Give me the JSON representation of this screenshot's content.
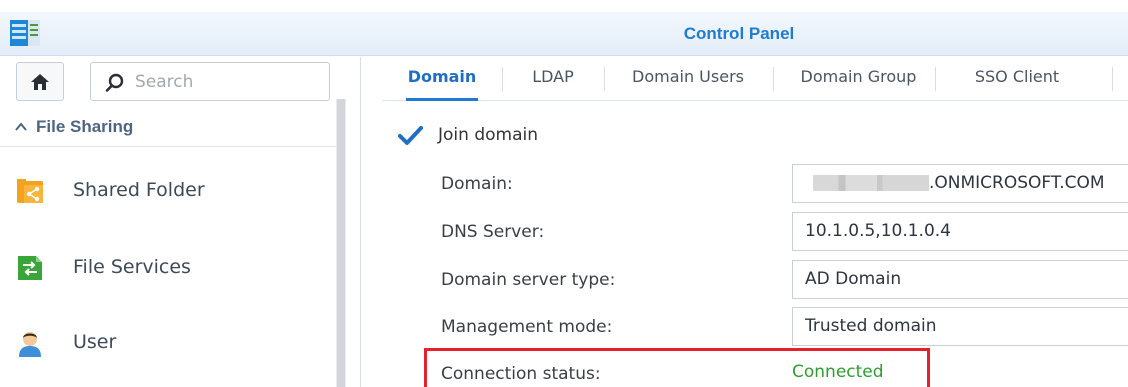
{
  "window": {
    "title": "Control Panel",
    "app_icon": "synology-control-panel-icon"
  },
  "sidebar": {
    "home_icon": "home-icon",
    "search": {
      "placeholder": "Search",
      "value": "",
      "icon": "search-icon"
    },
    "section": {
      "label": "File Sharing",
      "icon": "chevron-up-icon"
    },
    "items": [
      {
        "label": "Shared Folder",
        "icon": "shared-folder-icon"
      },
      {
        "label": "File Services",
        "icon": "file-services-icon"
      },
      {
        "label": "User",
        "icon": "user-icon"
      }
    ]
  },
  "tabs": [
    {
      "label": "Domain",
      "active": true
    },
    {
      "label": "LDAP",
      "active": false
    },
    {
      "label": "Domain Users",
      "active": false
    },
    {
      "label": "Domain Group",
      "active": false
    },
    {
      "label": "SSO Client",
      "active": false
    }
  ],
  "form": {
    "join_domain": {
      "label": "Join domain",
      "checked": true
    },
    "fields": [
      {
        "label": "Domain:",
        "value": ".ONMICROSOFT.COM",
        "redacted_prefix": true
      },
      {
        "label": "DNS Server:",
        "value": "10.1.0.5,10.1.0.4"
      },
      {
        "label": "Domain server type:",
        "value": "AD Domain"
      },
      {
        "label": "Management mode:",
        "value": "Trusted domain"
      }
    ],
    "connection_status": {
      "label": "Connection status:",
      "value": "Connected"
    }
  },
  "colors": {
    "accent": "#1f7ad1",
    "status_ok": "#2e9e2e",
    "highlight_box": "#e3222d"
  }
}
